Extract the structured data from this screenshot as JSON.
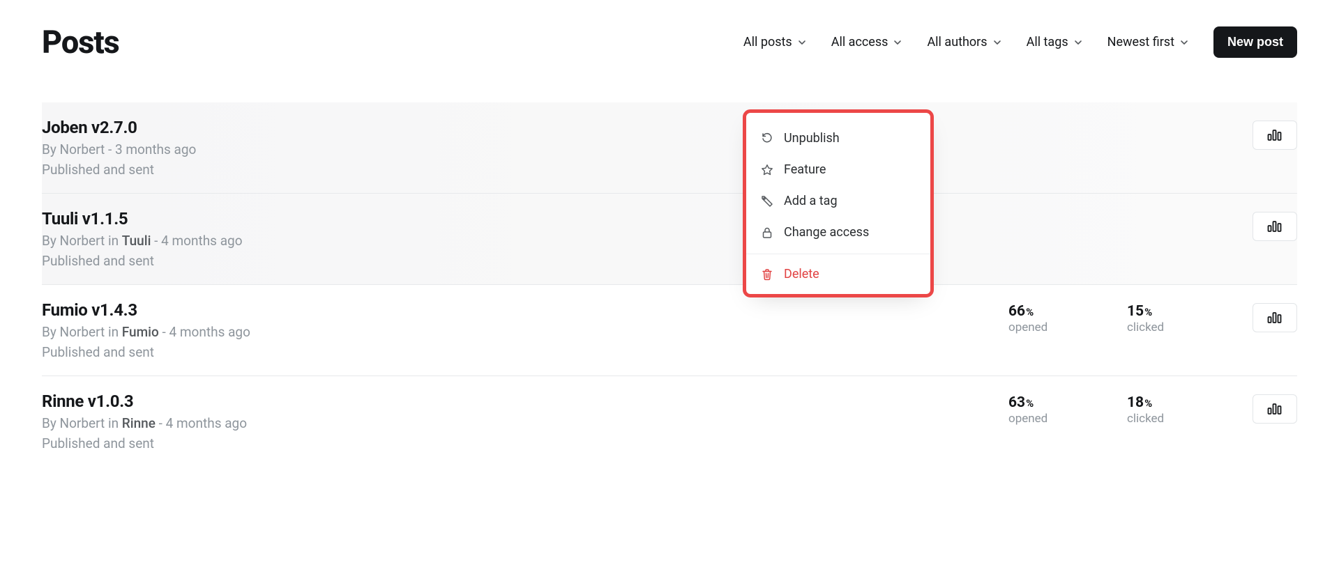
{
  "header": {
    "title": "Posts",
    "new_post_label": "New post"
  },
  "filters": [
    {
      "label": "All posts"
    },
    {
      "label": "All access"
    },
    {
      "label": "All authors"
    },
    {
      "label": "All tags"
    },
    {
      "label": "Newest first"
    }
  ],
  "context_menu": {
    "unpublish": "Unpublish",
    "feature": "Feature",
    "add_tag": "Add a tag",
    "change_access": "Change access",
    "delete": "Delete"
  },
  "posts": [
    {
      "title": "Joben v2.7.0",
      "by_prefix": "By ",
      "author": "Norbert",
      "category": "",
      "sep": " - ",
      "ago": "3 months ago",
      "status": "Published and sent",
      "selected": true,
      "opened_value": "",
      "opened_label": "",
      "clicked_value": "",
      "clicked_label": ""
    },
    {
      "title": "Tuuli v1.1.5",
      "by_prefix": "By ",
      "author": "Norbert",
      "in_word": " in ",
      "category": "Tuuli",
      "sep": " - ",
      "ago": "4 months ago",
      "status": "Published and sent",
      "selected": true,
      "opened_value": "",
      "opened_label": "",
      "clicked_value": "",
      "clicked_label": ""
    },
    {
      "title": "Fumio v1.4.3",
      "by_prefix": "By ",
      "author": "Norbert",
      "in_word": " in ",
      "category": "Fumio",
      "sep": " - ",
      "ago": "4 months ago",
      "status": "Published and sent",
      "selected": false,
      "opened_value": "66",
      "opened_unit": "%",
      "opened_label": "opened",
      "clicked_value": "15",
      "clicked_unit": "%",
      "clicked_label": "clicked"
    },
    {
      "title": "Rinne v1.0.3",
      "by_prefix": "By ",
      "author": "Norbert",
      "in_word": " in ",
      "category": "Rinne",
      "sep": " - ",
      "ago": "4 months ago",
      "status": "Published and sent",
      "selected": false,
      "opened_value": "63",
      "opened_unit": "%",
      "opened_label": "opened",
      "clicked_value": "18",
      "clicked_unit": "%",
      "clicked_label": "clicked"
    }
  ]
}
